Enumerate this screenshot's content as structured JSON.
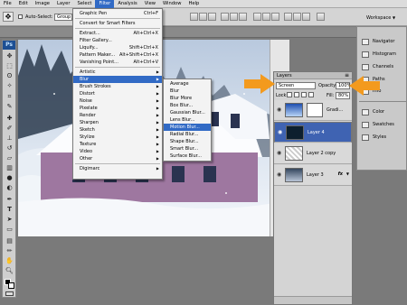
{
  "menubar": {
    "items": [
      "File",
      "Edit",
      "Image",
      "Layer",
      "Select",
      "Filter",
      "Analysis",
      "View",
      "Window",
      "Help"
    ],
    "active_index": 5
  },
  "options": {
    "auto_select_label": "Auto-Select:",
    "auto_select_value": "Group",
    "workspace_label": "Workspace"
  },
  "tools": {
    "ps_logo": "Ps",
    "icons": [
      "move-tool",
      "marquee-tool",
      "lasso-tool",
      "magic-wand-tool",
      "crop-tool",
      "slice-tool",
      "healing-tool",
      "brush-tool",
      "stamp-tool",
      "history-brush-tool",
      "eraser-tool",
      "gradient-tool",
      "blur-tool",
      "dodge-tool",
      "pen-tool",
      "type-tool",
      "path-select-tool",
      "shape-tool",
      "notes-tool",
      "eyedropper-tool",
      "hand-tool",
      "zoom-tool"
    ]
  },
  "filter_menu": {
    "items": [
      {
        "label": "Graphic Pen",
        "shortcut": "Ctrl+F"
      },
      {
        "sep": true
      },
      {
        "label": "Convert for Smart Filters"
      },
      {
        "sep": true
      },
      {
        "label": "Extract...",
        "shortcut": "Alt+Ctrl+X"
      },
      {
        "label": "Filter Gallery..."
      },
      {
        "label": "Liquify...",
        "shortcut": "Shift+Ctrl+X"
      },
      {
        "label": "Pattern Maker...",
        "shortcut": "Alt+Shift+Ctrl+X"
      },
      {
        "label": "Vanishing Point...",
        "shortcut": "Alt+Ctrl+V"
      },
      {
        "sep": true
      },
      {
        "label": "Artistic",
        "submenu": true
      },
      {
        "label": "Blur",
        "submenu": true,
        "highlight": true
      },
      {
        "label": "Brush Strokes",
        "submenu": true
      },
      {
        "label": "Distort",
        "submenu": true
      },
      {
        "label": "Noise",
        "submenu": true
      },
      {
        "label": "Pixelate",
        "submenu": true
      },
      {
        "label": "Render",
        "submenu": true
      },
      {
        "label": "Sharpen",
        "submenu": true
      },
      {
        "label": "Sketch",
        "submenu": true
      },
      {
        "label": "Stylize",
        "submenu": true
      },
      {
        "label": "Texture",
        "submenu": true
      },
      {
        "label": "Video",
        "submenu": true
      },
      {
        "label": "Other",
        "submenu": true
      },
      {
        "sep": true
      },
      {
        "label": "Digimarc",
        "submenu": true
      }
    ]
  },
  "blur_submenu": {
    "items": [
      {
        "label": "Average"
      },
      {
        "label": "Blur"
      },
      {
        "label": "Blur More"
      },
      {
        "label": "Box Blur..."
      },
      {
        "label": "Gaussian Blur..."
      },
      {
        "label": "Lens Blur..."
      },
      {
        "label": "Motion Blur...",
        "highlight": true
      },
      {
        "label": "Radial Blur..."
      },
      {
        "label": "Shape Blur..."
      },
      {
        "label": "Smart Blur..."
      },
      {
        "label": "Surface Blur..."
      }
    ]
  },
  "layers_panel": {
    "tab_label": "Layers",
    "blend_mode": "Screen",
    "opacity_label": "Opacity:",
    "opacity_value": "100%",
    "lock_label": "Lock:",
    "fill_label": "Fill:",
    "fill_value": "80%",
    "layers": [
      {
        "name": "Gradi...",
        "selected": false
      },
      {
        "name": "Layer 4",
        "selected": true
      },
      {
        "name": "Layer 2 copy",
        "selected": false
      },
      {
        "name": "Layer 3",
        "selected": false
      }
    ]
  },
  "dock": {
    "items": [
      "Navigator",
      "Histogram",
      "Channels",
      "Paths",
      "Info",
      "Color",
      "Swatches",
      "Styles"
    ]
  },
  "colors": {
    "highlight": "#316ac5",
    "arrow": "#f39a1e",
    "layer_selected": "#3f63b2"
  }
}
